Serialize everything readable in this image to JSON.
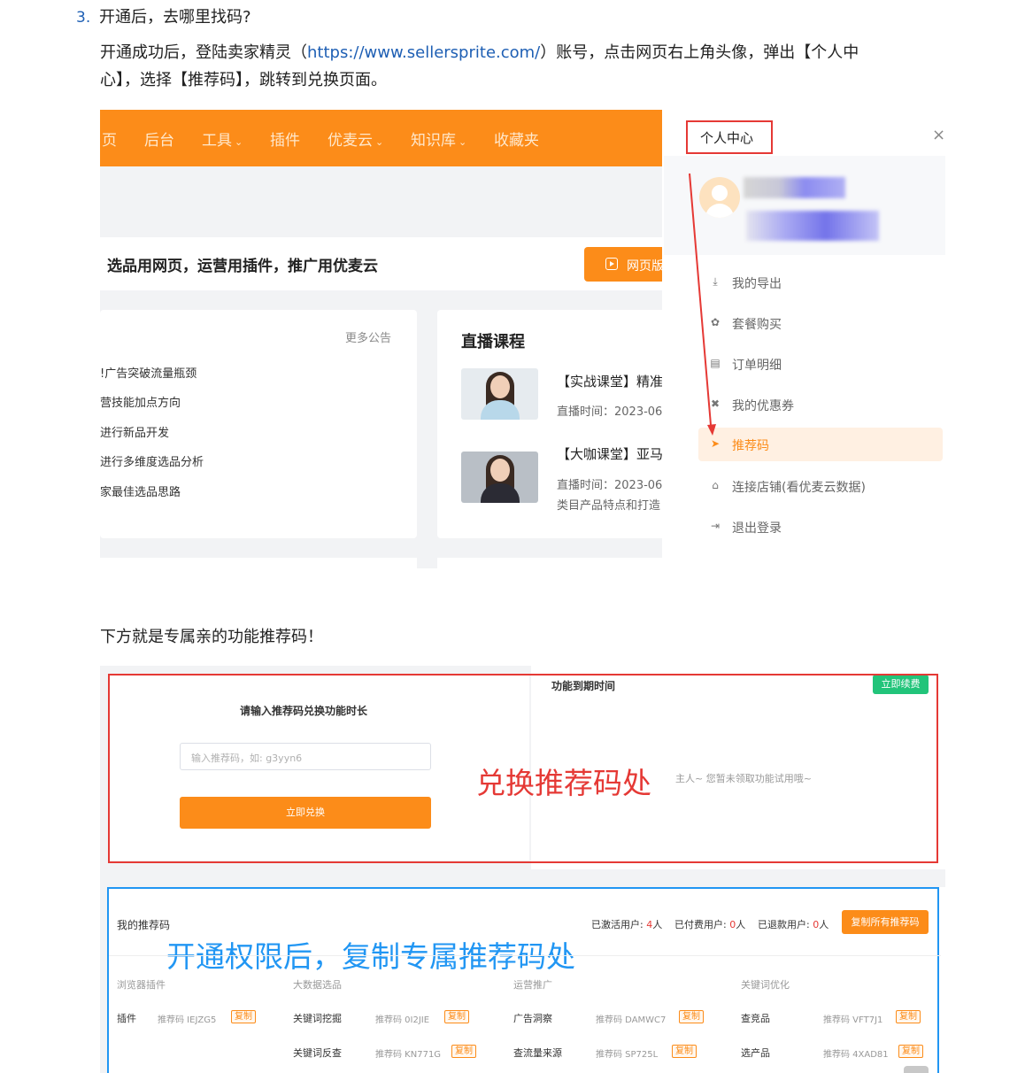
{
  "doc": {
    "step_number": "3.",
    "step_heading": "开通后，去哪里找码?",
    "para1_before_link": "开通成功后，登陆卖家精灵（",
    "para1_link": "https://www.sellersprite.com/",
    "para1_after_link": "）账号，点击网页右上角头像，弹出【个人中",
    "para1_line2": "心】，选择【推荐码】，跳转到兑换页面。",
    "para2": "下方就是专属亲的功能推荐码！"
  },
  "shot1": {
    "nav": [
      {
        "label": "页",
        "chevron": false
      },
      {
        "label": "后台",
        "chevron": false
      },
      {
        "label": "工具",
        "chevron": true
      },
      {
        "label": "插件",
        "chevron": false
      },
      {
        "label": "优麦云",
        "chevron": true
      },
      {
        "label": "知识库",
        "chevron": true
      },
      {
        "label": "收藏夹",
        "chevron": false
      }
    ],
    "slogan": "选品用网页，运营用插件，推广用优麦云",
    "web_button": "网页版",
    "more_notice": "更多公告",
    "notices": [
      "!广告突破流量瓶颈",
      "营技能加点方向",
      "进行新品开发",
      "进行多维度选品分析",
      "家最佳选品思路"
    ],
    "live_title": "直播课程",
    "courses": [
      {
        "title": "【实战课堂】精准",
        "time": "直播时间：2023-06",
        "extra": ""
      },
      {
        "title": "【大咖课堂】亚马",
        "time": "直播时间：2023-06",
        "extra": "类目产品特点和打造"
      }
    ],
    "panel": {
      "title": "个人中心",
      "close": "×",
      "menu": [
        {
          "label": "我的导出",
          "icon": "download-icon",
          "glyph": "⤓",
          "active": false
        },
        {
          "label": "套餐购买",
          "icon": "package-icon",
          "glyph": "✿",
          "active": false
        },
        {
          "label": "订单明细",
          "icon": "order-icon",
          "glyph": "▤",
          "active": false
        },
        {
          "label": "我的优惠券",
          "icon": "coupon-icon",
          "glyph": "✖",
          "active": false
        },
        {
          "label": "推荐码",
          "icon": "paper-plane-icon",
          "glyph": "➤",
          "active": true
        },
        {
          "label": "连接店铺(看优麦云数据)",
          "icon": "store-icon",
          "glyph": "⌂",
          "active": false
        },
        {
          "label": "退出登录",
          "icon": "logout-icon",
          "glyph": "⇥",
          "active": false
        }
      ]
    },
    "colors": {
      "brand_orange": "#fc8c19",
      "annotation_red": "#e53935"
    }
  },
  "shot2": {
    "redeem_title": "请输入推荐码兑换功能时长",
    "redeem_placeholder": "输入推荐码，如: g3yyn6",
    "redeem_button": "立即兑换",
    "expire_title": "功能到期时间",
    "renew_button": "立即续费",
    "empty_note": "主人~ 您暂未领取功能试用哦~",
    "annotation_red": "兑换推荐码处",
    "my_codes_title": "我的推荐码",
    "stats": [
      {
        "label": "已激活用户: ",
        "value": "4",
        "unit": "人"
      },
      {
        "label": "已付费用户: ",
        "value": "0",
        "unit": "人"
      },
      {
        "label": "已退款用户: ",
        "value": "0",
        "unit": "人"
      }
    ],
    "copy_all_button": "复制所有推荐码",
    "annotation_blue": "开通权限后，复制专属推荐码处",
    "categories": [
      "浏览器插件",
      "大数据选品",
      "运营推广",
      "关键词优化"
    ],
    "rows": [
      [
        {
          "feature": "插件",
          "code": "推荐码 IEJZG5",
          "copy": "复制"
        },
        {
          "feature": "关键词挖掘",
          "code": "推荐码 0I2JIE",
          "copy": "复制"
        },
        {
          "feature": "广告洞察",
          "code": "推荐码 DAMWC7",
          "copy": "复制"
        },
        {
          "feature": "查竞品",
          "code": "推荐码 VFT7J1",
          "copy": "复制"
        }
      ],
      [
        {
          "feature": "关键词反查",
          "code": "推荐码 KN771G",
          "copy": "复制"
        },
        {
          "feature": "查流量来源",
          "code": "推荐码 SP725L",
          "copy": "复制"
        },
        {
          "feature": "选产品",
          "code": "推荐码 4XAD81",
          "copy": "复制"
        }
      ]
    ],
    "colors": {
      "renew_green": "#22c47a",
      "annotation_blue": "#2196f3"
    }
  }
}
